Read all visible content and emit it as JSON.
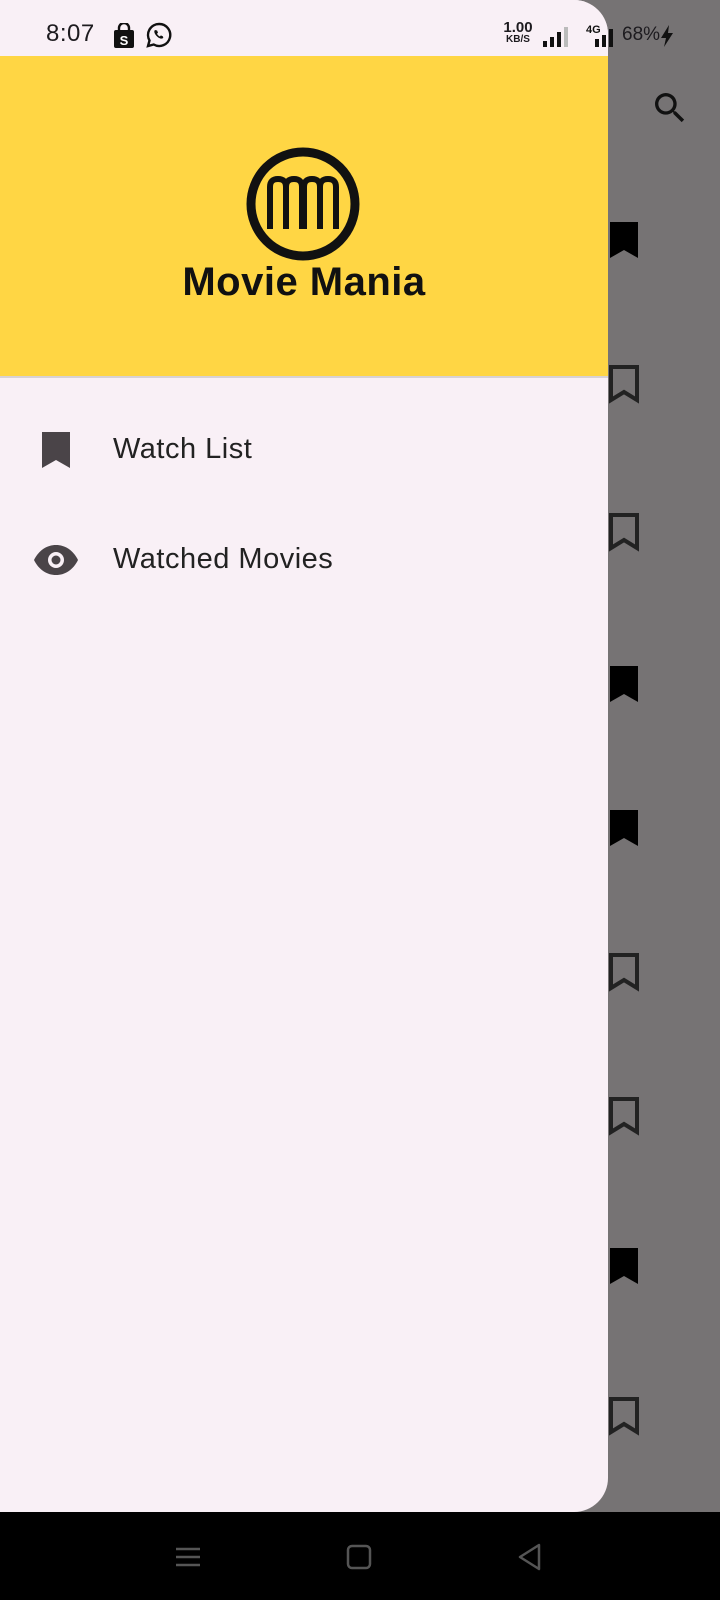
{
  "status_bar": {
    "time": "8:07",
    "net_speed_value": "1.00",
    "net_speed_unit": "KB/S",
    "network_type": "4G",
    "battery": "68%",
    "icons": [
      "shopping-bag-icon",
      "whatsapp-icon",
      "signal-icon",
      "signal-4g-icon",
      "charging-icon"
    ]
  },
  "drawer": {
    "app_name": "Movie Mania",
    "logo_text": "MM",
    "header_color": "#ffd644",
    "items": [
      {
        "label": "Watch List",
        "icon": "bookmark-icon"
      },
      {
        "label": "Watched Movies",
        "icon": "eye-icon"
      }
    ]
  },
  "background_app": {
    "search_icon": "search-icon",
    "bookmark_states": [
      "filled",
      "outline",
      "outline",
      "filled",
      "filled",
      "outline",
      "outline",
      "filled",
      "outline"
    ]
  },
  "nav_bar": {
    "buttons": [
      "menu-button",
      "home-button",
      "back-button"
    ]
  },
  "colors": {
    "scrim": "#767374",
    "drawer_bg": "#f9f0f6",
    "accent": "#ffd644",
    "icon": "#4a4448"
  }
}
